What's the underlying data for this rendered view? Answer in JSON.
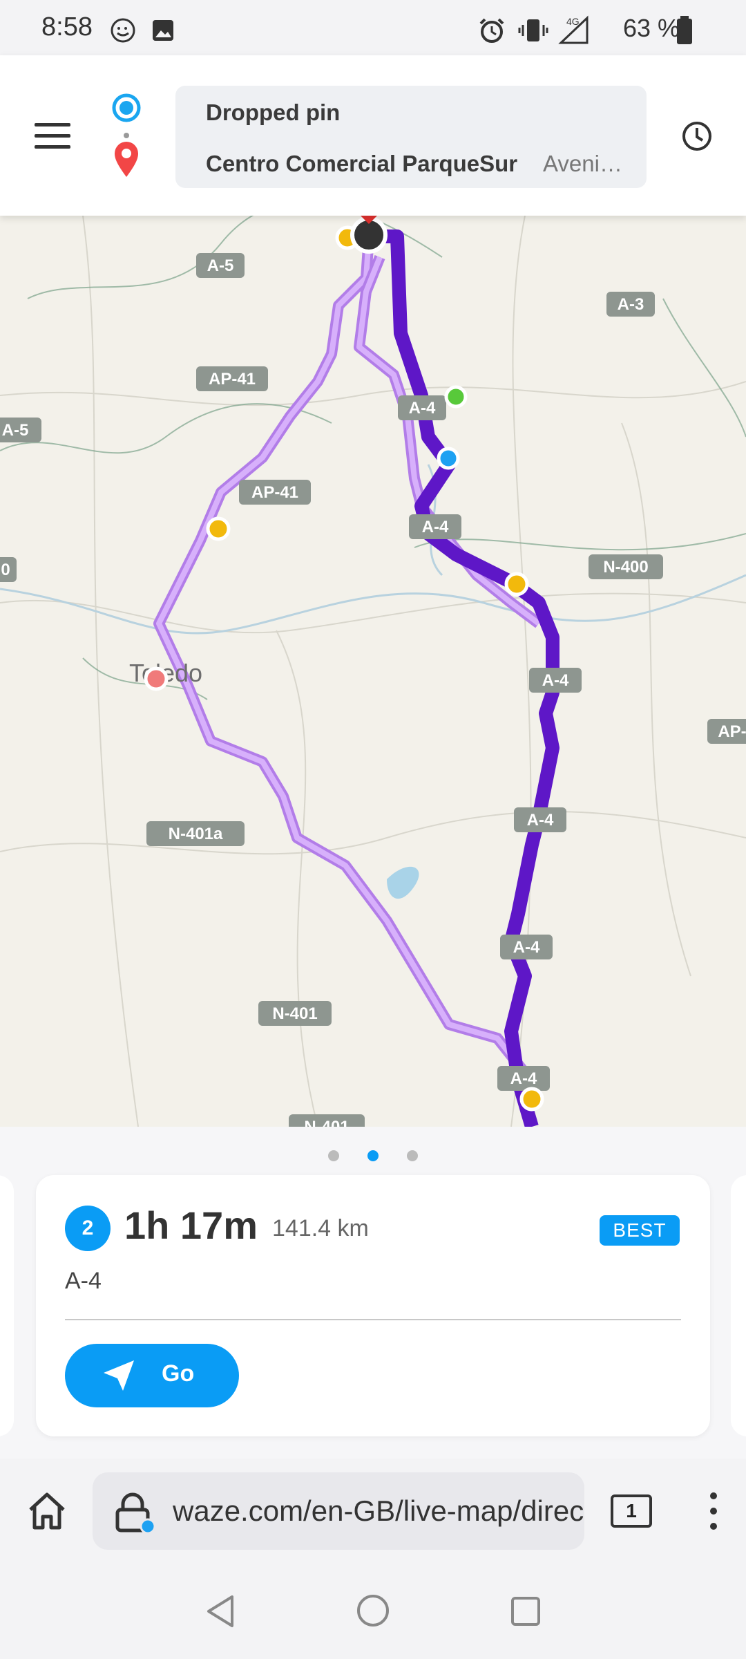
{
  "status_bar": {
    "time": "8:58",
    "battery": "63 %",
    "network": "4G",
    "icons": [
      "waze-icon",
      "image-icon",
      "alarm-icon",
      "vibrate-icon",
      "signal-icon",
      "battery-icon"
    ]
  },
  "header": {
    "from": "Dropped pin",
    "to": "Centro Comercial ParqueSur",
    "to_subtitle": "Aveni…"
  },
  "map": {
    "labels": {
      "a5_top": "A-5",
      "a5_left": "A-5",
      "a3": "A-3",
      "ap41_top": "AP-41",
      "ap41_mid": "AP-41",
      "a4_1": "A-4",
      "a4_2": "A-4",
      "a4_3": "A-4",
      "a4_4": "A-4",
      "a4_5": "A-4",
      "a4_6": "A-4",
      "n400": "N-400",
      "ap_right": "AP-",
      "n401a": "N-401a",
      "n401": "N-401",
      "n401_bottom": "N-401",
      "toledo": "Toledo",
      "left_edge": "0"
    },
    "colors": {
      "primary_route": "#5e17c7",
      "alt_route": "#c48af7",
      "background": "#f3f1ea"
    }
  },
  "pager": {
    "count": 3,
    "active": 2
  },
  "route_card": {
    "index": "2",
    "duration": "1h 17m",
    "distance": "141.4 km",
    "badge": "BEST",
    "road": "A-4",
    "go_label": "Go"
  },
  "browser": {
    "url": "waze.com/en-GB/live-map/direc",
    "tab_count": "1"
  },
  "colors": {
    "accent": "#0a9cf5"
  }
}
